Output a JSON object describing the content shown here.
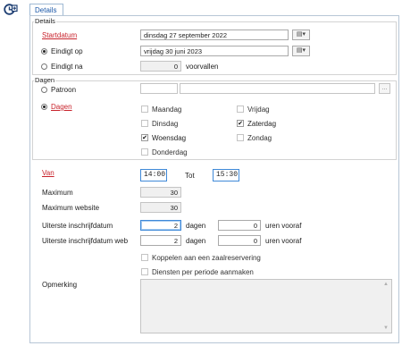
{
  "tab": {
    "label": "Details"
  },
  "details": {
    "group_title": "Details",
    "startdatum_label": "Startdatum",
    "startdatum_value": "dinsdag 27 september 2022",
    "eindigt_op_label": "Eindigt op",
    "eindigt_op_value": "vrijdag 30 juni 2023",
    "eindigt_na_label": "Eindigt na",
    "eindigt_na_value": "0",
    "eindigt_na_suffix": "voorvallen",
    "cal_button": "▤▾"
  },
  "dagen": {
    "group_title": "Dagen",
    "patroon_label": "Patroon",
    "dagen_label": "Dagen",
    "dots_button": "...",
    "days": {
      "maandag": {
        "label": "Maandag",
        "checked": false
      },
      "dinsdag": {
        "label": "Dinsdag",
        "checked": false
      },
      "woensdag": {
        "label": "Woensdag",
        "checked": true
      },
      "donderdag": {
        "label": "Donderdag",
        "checked": false
      },
      "vrijdag": {
        "label": "Vrijdag",
        "checked": false
      },
      "zaterdag": {
        "label": "Zaterdag",
        "checked": true
      },
      "zondag": {
        "label": "Zondag",
        "checked": false
      }
    },
    "check_mark": "✔"
  },
  "time": {
    "van_label": "Van",
    "van_value": "14:00",
    "tot_label": "Tot",
    "tot_value": "15:30"
  },
  "limits": {
    "maximum_label": "Maximum",
    "maximum_value": "30",
    "maximum_website_label": "Maximum website",
    "maximum_website_value": "30"
  },
  "deadline": {
    "label": "Uiterste inschrijfdatum",
    "days_value": "2",
    "days_suffix": "dagen",
    "hours_value": "0",
    "hours_suffix": "uren vooraf",
    "web_label": "Uiterste inschrijfdatum web",
    "web_days_value": "2",
    "web_days_suffix": "dagen",
    "web_hours_value": "0",
    "web_hours_suffix": "uren vooraf"
  },
  "options": {
    "koppelen_label": "Koppelen aan een zaalreservering",
    "diensten_label": "Diensten per periode aanmaken"
  },
  "opmerking": {
    "label": "Opmerking",
    "value": ""
  }
}
